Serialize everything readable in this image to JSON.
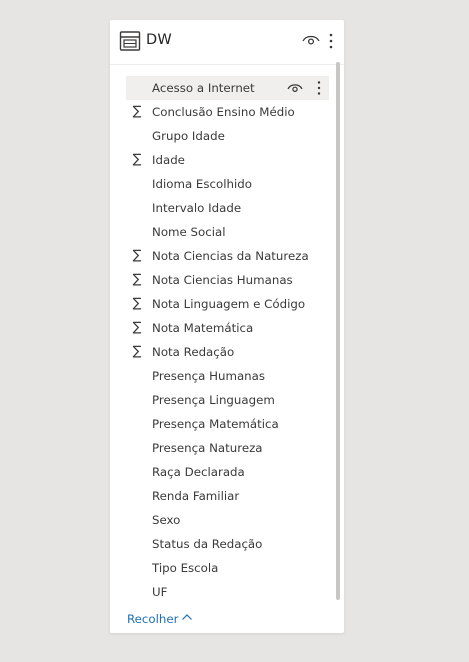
{
  "header": {
    "title": "DW"
  },
  "fields": [
    {
      "label": "Acesso a Internet",
      "sigma": false,
      "hovered": true
    },
    {
      "label": "Conclusão Ensino Médio",
      "sigma": true
    },
    {
      "label": "Grupo Idade",
      "sigma": false
    },
    {
      "label": "Idade",
      "sigma": true
    },
    {
      "label": "Idioma Escolhido",
      "sigma": false
    },
    {
      "label": "Intervalo Idade",
      "sigma": false
    },
    {
      "label": "Nome Social",
      "sigma": false
    },
    {
      "label": "Nota Ciencias da Natureza",
      "sigma": true
    },
    {
      "label": "Nota Ciencias Humanas",
      "sigma": true
    },
    {
      "label": "Nota Linguagem e Código",
      "sigma": true
    },
    {
      "label": "Nota Matemática",
      "sigma": true
    },
    {
      "label": "Nota Redação",
      "sigma": true
    },
    {
      "label": "Presença Humanas",
      "sigma": false
    },
    {
      "label": "Presença Linguagem",
      "sigma": false
    },
    {
      "label": "Presença Matemática",
      "sigma": false
    },
    {
      "label": "Presença Natureza",
      "sigma": false
    },
    {
      "label": "Raça Declarada",
      "sigma": false
    },
    {
      "label": "Renda Familiar",
      "sigma": false
    },
    {
      "label": "Sexo",
      "sigma": false
    },
    {
      "label": "Status da Redação",
      "sigma": false
    },
    {
      "label": "Tipo Escola",
      "sigma": false
    },
    {
      "label": "UF",
      "sigma": false
    }
  ],
  "sigma_symbol": "∑",
  "collapse_label": "Recolher",
  "icons": {
    "table": "table-icon",
    "eye": "eye-icon",
    "more": "more-vertical-icon",
    "sum": "sigma-icon",
    "chevron": "chevron-up-icon"
  },
  "colors": {
    "background": "#e6e5e3",
    "panel": "#ffffff",
    "text": "#3b3a39",
    "link": "#1f6fb5",
    "hover": "#f0efee",
    "scrollbar": "#c8c6c4"
  }
}
